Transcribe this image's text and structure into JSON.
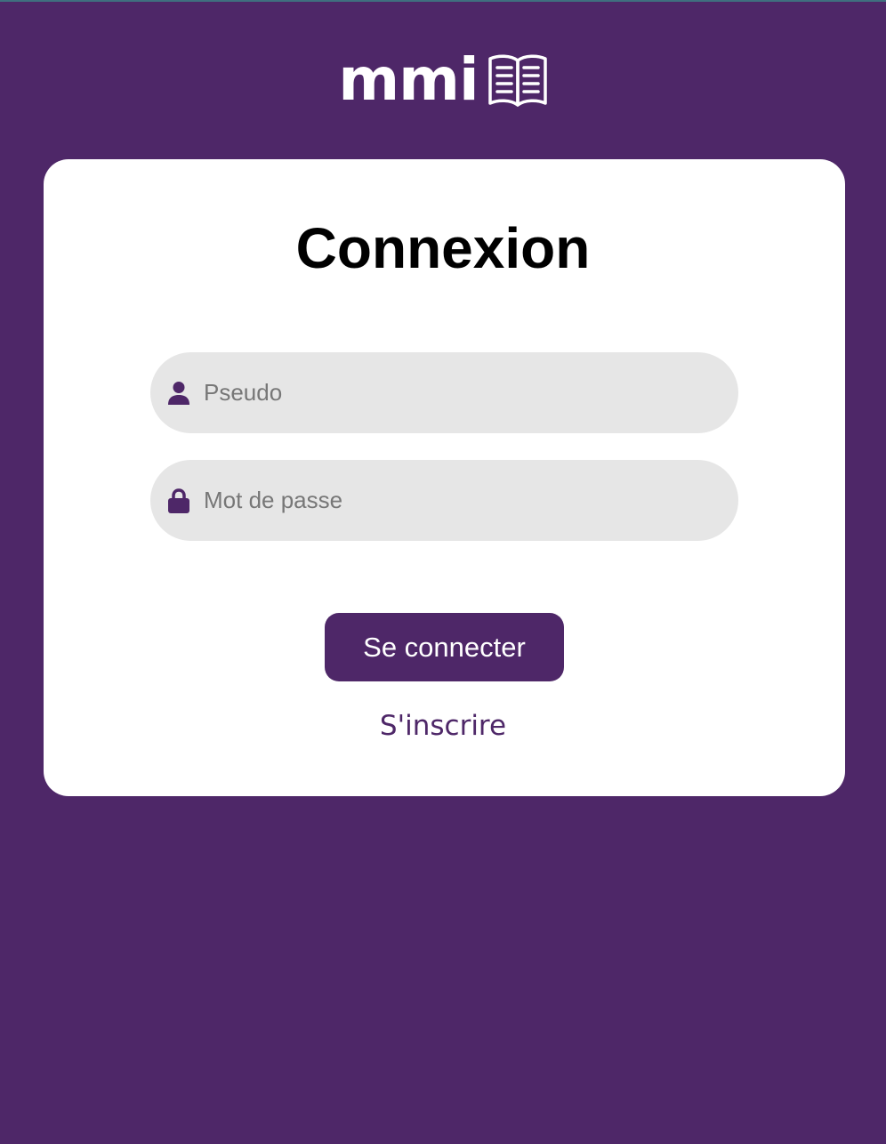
{
  "brand": {
    "logo_text": "mmi",
    "logo_icon": "open-book-icon"
  },
  "login": {
    "title": "Connexion",
    "username": {
      "icon": "user-icon",
      "placeholder": "Pseudo",
      "value": ""
    },
    "password": {
      "icon": "lock-icon",
      "placeholder": "Mot de passe",
      "value": ""
    },
    "submit_label": "Se connecter",
    "register_link": "S'inscrire"
  },
  "colors": {
    "background": "#4e2768",
    "card": "#ffffff",
    "field_background": "#e6e6e6",
    "accent": "#4e2768",
    "title_text": "#000000"
  }
}
